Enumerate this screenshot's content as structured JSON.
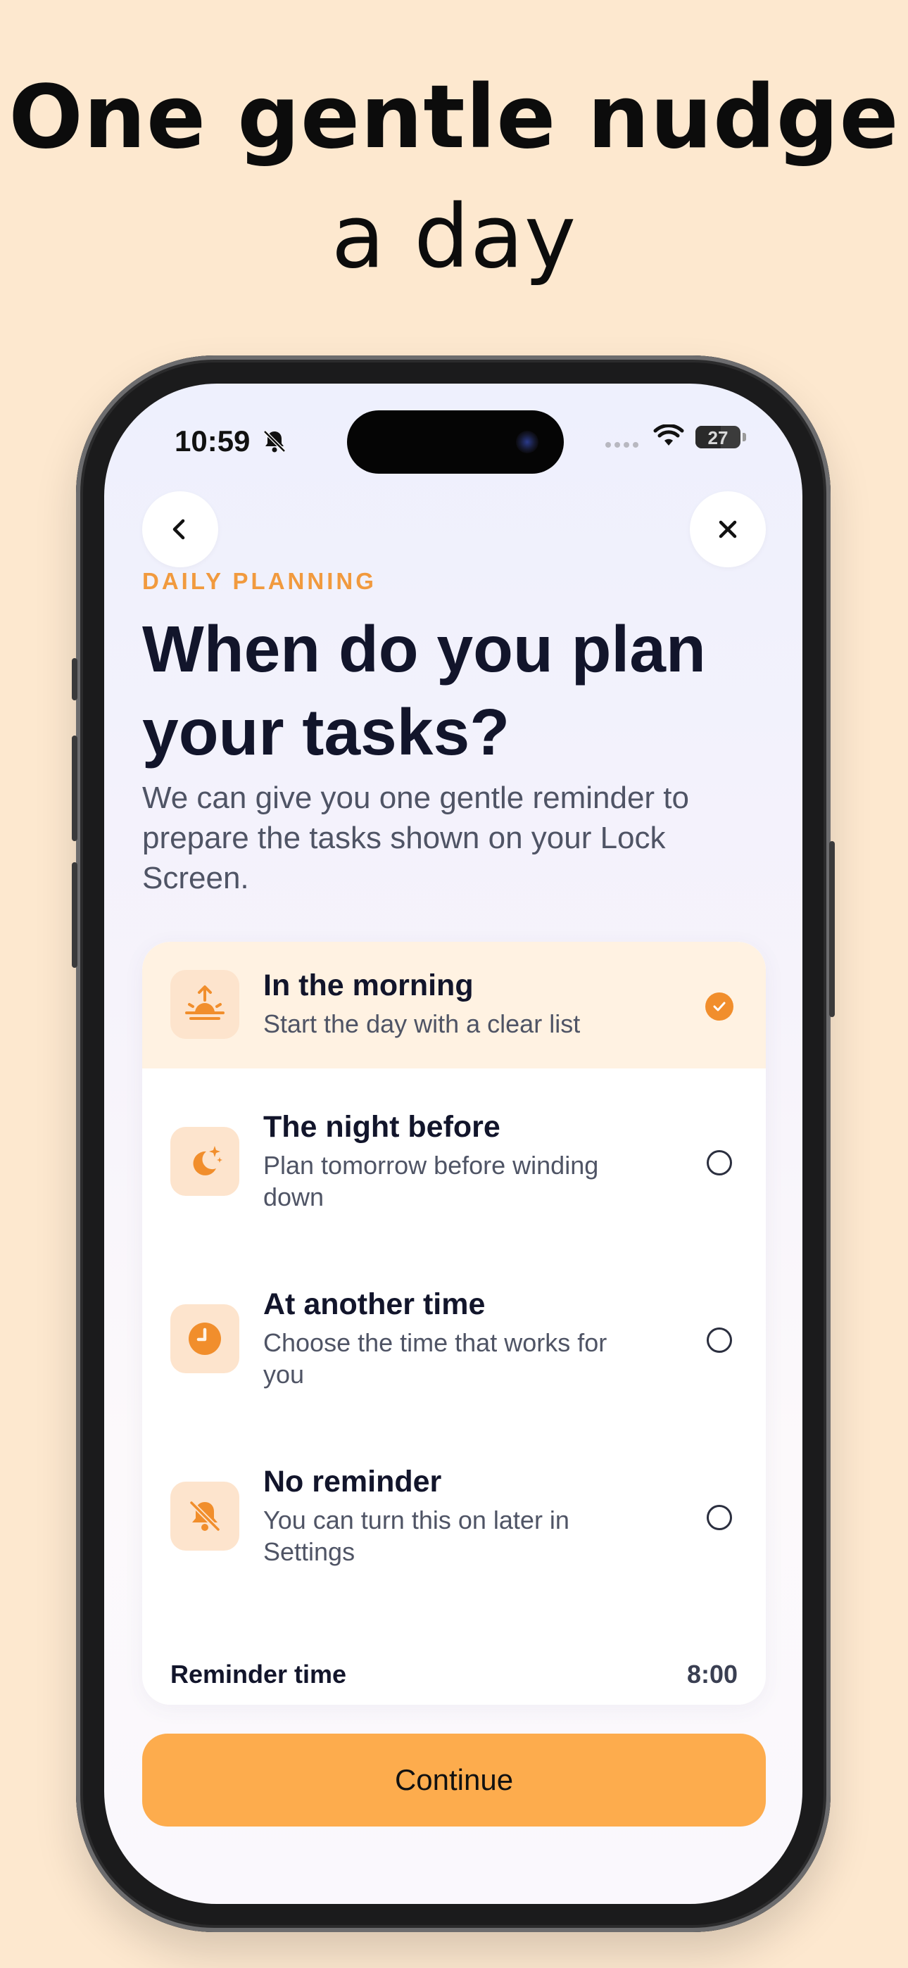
{
  "headline": {
    "line1": "One gentle nudge",
    "line2": "a day"
  },
  "status_bar": {
    "time": "10:59",
    "battery": "27"
  },
  "nav": {
    "back_icon": "chevron-left-icon",
    "close_icon": "close-icon"
  },
  "header": {
    "eyebrow": "DAILY PLANNING",
    "title_line1": "When do you plan",
    "title_line2": "your tasks?",
    "subtitle": "We can give you one gentle reminder to prepare the tasks shown on your Lock Screen."
  },
  "options": [
    {
      "title": "In the morning",
      "desc": "Start the day with a clear list",
      "icon": "sunrise-icon",
      "selected": true
    },
    {
      "title": "The night before",
      "desc": "Plan tomorrow before winding down",
      "icon": "moon-stars-icon",
      "selected": false
    },
    {
      "title": "At another time",
      "desc": "Choose the time that works for you",
      "icon": "clock-icon",
      "selected": false
    },
    {
      "title": "No reminder",
      "desc": "You can turn this on later in Settings",
      "icon": "bell-slash-icon",
      "selected": false
    }
  ],
  "reminder": {
    "label": "Reminder time",
    "value": "8:00"
  },
  "continue_label": "Continue",
  "colors": {
    "background": "#fde8cf",
    "accent": "#f18e2c",
    "button": "#fdac4d",
    "text": "#12152b"
  }
}
